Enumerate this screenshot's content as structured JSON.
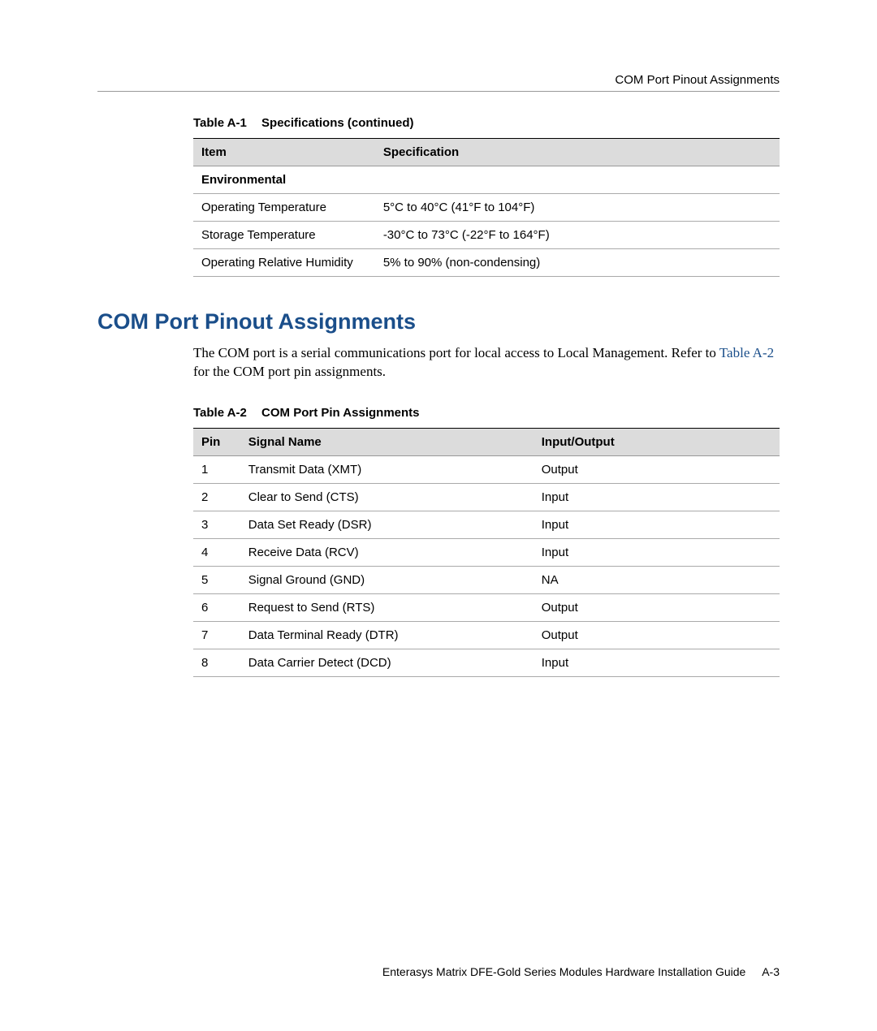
{
  "header": {
    "title": "COM Port Pinout Assignments"
  },
  "table1": {
    "caption_num": "Table A-1",
    "caption_title": "Specifications (continued)",
    "cols": [
      "Item",
      "Specification"
    ],
    "section_label": "Environmental",
    "rows": [
      {
        "item": "Operating Temperature",
        "spec": "5°C to 40°C (41°F to 104°F)"
      },
      {
        "item": "Storage Temperature",
        "spec": "-30°C to 73°C (-22°F to 164°F)"
      },
      {
        "item": "Operating Relative Humidity",
        "spec": "5% to 90% (non-condensing)"
      }
    ]
  },
  "section": {
    "heading": "COM Port Pinout Assignments",
    "body_pre": "The COM port is a serial communications port for local access to Local Management. Refer to ",
    "body_link": "Table A-2",
    "body_post": " for the COM port pin assignments."
  },
  "table2": {
    "caption_num": "Table A-2",
    "caption_title": "COM Port Pin Assignments",
    "cols": [
      "Pin",
      "Signal Name",
      "Input/Output"
    ],
    "rows": [
      {
        "pin": "1",
        "name": "Transmit Data (XMT)",
        "io": "Output"
      },
      {
        "pin": "2",
        "name": "Clear to Send (CTS)",
        "io": "Input"
      },
      {
        "pin": "3",
        "name": "Data Set Ready (DSR)",
        "io": "Input"
      },
      {
        "pin": "4",
        "name": "Receive Data (RCV)",
        "io": "Input"
      },
      {
        "pin": "5",
        "name": "Signal Ground (GND)",
        "io": "NA"
      },
      {
        "pin": "6",
        "name": "Request to Send (RTS)",
        "io": "Output"
      },
      {
        "pin": "7",
        "name": "Data Terminal Ready (DTR)",
        "io": "Output"
      },
      {
        "pin": "8",
        "name": "Data Carrier Detect (DCD)",
        "io": "Input"
      }
    ]
  },
  "footer": {
    "text": "Enterasys Matrix DFE-Gold Series Modules Hardware Installation Guide",
    "page": "A-3"
  }
}
